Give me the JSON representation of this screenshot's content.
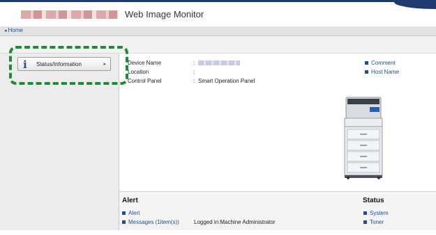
{
  "header": {
    "app_title": "Web Image Monitor",
    "accent": "#1f3a6e"
  },
  "breadcrumb": {
    "home_label": "Home"
  },
  "sidebar": {
    "status_button_label": "Status/Information",
    "highlight_color": "#1f8a3a"
  },
  "device_info": [
    {
      "key": "Device Name",
      "value": ""
    },
    {
      "key": "Location",
      "value": ""
    },
    {
      "key": "Control Panel",
      "value": "Smart Operation Panel"
    }
  ],
  "right_links": [
    "Comment",
    "Host Name"
  ],
  "alert": {
    "title": "Alert",
    "links": [
      "Alert",
      "Messages (1item(s))"
    ],
    "logged_in_text": "Logged in:Machine Administrator"
  },
  "status": {
    "title": "Status",
    "links": [
      "System",
      "Toner"
    ]
  }
}
